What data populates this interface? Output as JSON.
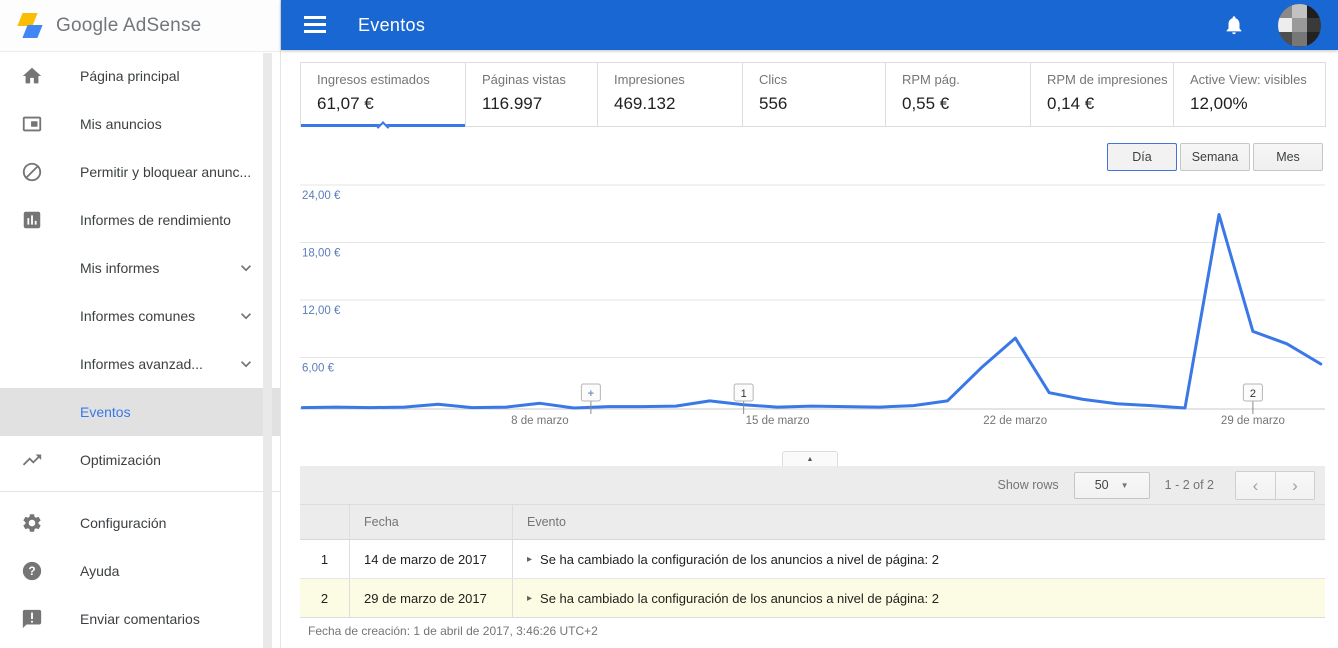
{
  "brand": {
    "logo_text_1": "Google",
    "logo_text_2": "AdSense"
  },
  "header": {
    "title": "Eventos"
  },
  "sidebar": {
    "items": [
      {
        "label": "Página principal",
        "icon": "home-icon"
      },
      {
        "label": "Mis anuncios",
        "icon": "ads-icon"
      },
      {
        "label": "Permitir y bloquear anunc...",
        "icon": "block-icon"
      },
      {
        "label": "Informes de rendimiento",
        "icon": "performance-reports-icon"
      },
      {
        "label": "Mis informes",
        "chevron": true
      },
      {
        "label": "Informes comunes",
        "chevron": true
      },
      {
        "label": "Informes avanzad...",
        "chevron": true
      },
      {
        "label": "Eventos",
        "selected": true
      },
      {
        "label": "Optimización",
        "icon": "optimization-icon"
      },
      {
        "divider": true
      },
      {
        "label": "Configuración",
        "icon": "settings-icon"
      },
      {
        "label": "Ayuda",
        "icon": "help-icon"
      },
      {
        "label": "Enviar comentarios",
        "icon": "feedback-icon"
      }
    ]
  },
  "stats": {
    "cards": [
      {
        "label": "Ingresos estimados",
        "value": "61,07 €",
        "selected": true
      },
      {
        "label": "Páginas vistas",
        "value": "116.997"
      },
      {
        "label": "Impresiones",
        "value": "469.132"
      },
      {
        "label": "Clics",
        "value": "556"
      },
      {
        "label": "RPM pág.",
        "value": "0,55 €"
      },
      {
        "label": "RPM de impresiones",
        "value": "0,14 €"
      },
      {
        "label": "Active View: visibles",
        "value": "12,00%"
      }
    ]
  },
  "range_toggle": {
    "options": [
      "Día",
      "Semana",
      "Mes"
    ],
    "selected": "Día"
  },
  "chart_data": {
    "type": "line",
    "series": [
      {
        "name": "Ingresos estimados",
        "values": [
          0.15,
          0.2,
          0.15,
          0.2,
          0.5,
          0.15,
          0.2,
          0.6,
          0.1,
          0.25,
          0.25,
          0.3,
          0.85,
          0.45,
          0.2,
          0.3,
          0.25,
          0.2,
          0.35,
          0.85,
          4.3,
          7.4,
          1.7,
          1.0,
          0.55,
          0.35,
          0.1,
          20.3,
          8.1,
          6.8,
          4.7
        ]
      }
    ],
    "categories": [
      "1 de marzo",
      "2 de marzo",
      "3 de marzo",
      "4 de marzo",
      "5 de marzo",
      "6 de marzo",
      "7 de marzo",
      "8 de marzo",
      "9 de marzo",
      "10 de marzo",
      "11 de marzo",
      "12 de marzo",
      "13 de marzo",
      "14 de marzo",
      "15 de marzo",
      "16 de marzo",
      "17 de marzo",
      "18 de marzo",
      "19 de marzo",
      "20 de marzo",
      "21 de marzo",
      "22 de marzo",
      "23 de marzo",
      "24 de marzo",
      "25 de marzo",
      "26 de marzo",
      "27 de marzo",
      "28 de marzo",
      "29 de marzo",
      "30 de marzo",
      "31 de marzo"
    ],
    "y_ticks": [
      {
        "value": 6,
        "label": "6,00 €"
      },
      {
        "value": 12,
        "label": "12,00 €"
      },
      {
        "value": 18,
        "label": "18,00 €"
      },
      {
        "value": 24,
        "label": "24,00 €"
      }
    ],
    "x_ticks": [
      {
        "day": 8,
        "label": "8 de marzo"
      },
      {
        "day": 15,
        "label": "15 de marzo"
      },
      {
        "day": 22,
        "label": "22 de marzo"
      },
      {
        "day": 29,
        "label": "29 de marzo"
      }
    ],
    "ylim": [
      0,
      25
    ],
    "grid": true,
    "legend": "none",
    "event_flags": [
      {
        "label": "+",
        "day": 9.5
      },
      {
        "label": "1",
        "day": 14
      },
      {
        "label": "2",
        "day": 29
      }
    ],
    "line_color": "#3b78e7"
  },
  "table": {
    "toolbar": {
      "show_rows_label": "Show rows",
      "page_size": "50",
      "range_label": "1 - 2 of 2"
    },
    "headers": {
      "index": "",
      "date": "Fecha",
      "event": "Evento"
    },
    "rows": [
      {
        "index": "1",
        "date": "14 de marzo de 2017",
        "event": "Se ha cambiado la configuración de los anuncios a nivel de página: 2",
        "highlight": false
      },
      {
        "index": "2",
        "date": "29 de marzo de 2017",
        "event": "Se ha cambiado la configuración de los anuncios a nivel de página: 2",
        "highlight": true
      }
    ]
  },
  "footer": {
    "created_label": "Fecha de creación: 1 de abril de 2017, 3:46:26 UTC+2"
  },
  "colors": {
    "header_blue": "#1967d2",
    "accent_blue": "#3b78e7",
    "chart_line": "#3b78e7",
    "selected_nav_text": "#3b78e7",
    "selected_nav_bg": "#e1e1e1",
    "row_highlight": "#fbfce3",
    "logo_yellow": "#fbbc04",
    "logo_blue": "#4285f4",
    "axis_label_blue": "#5b7db8"
  }
}
